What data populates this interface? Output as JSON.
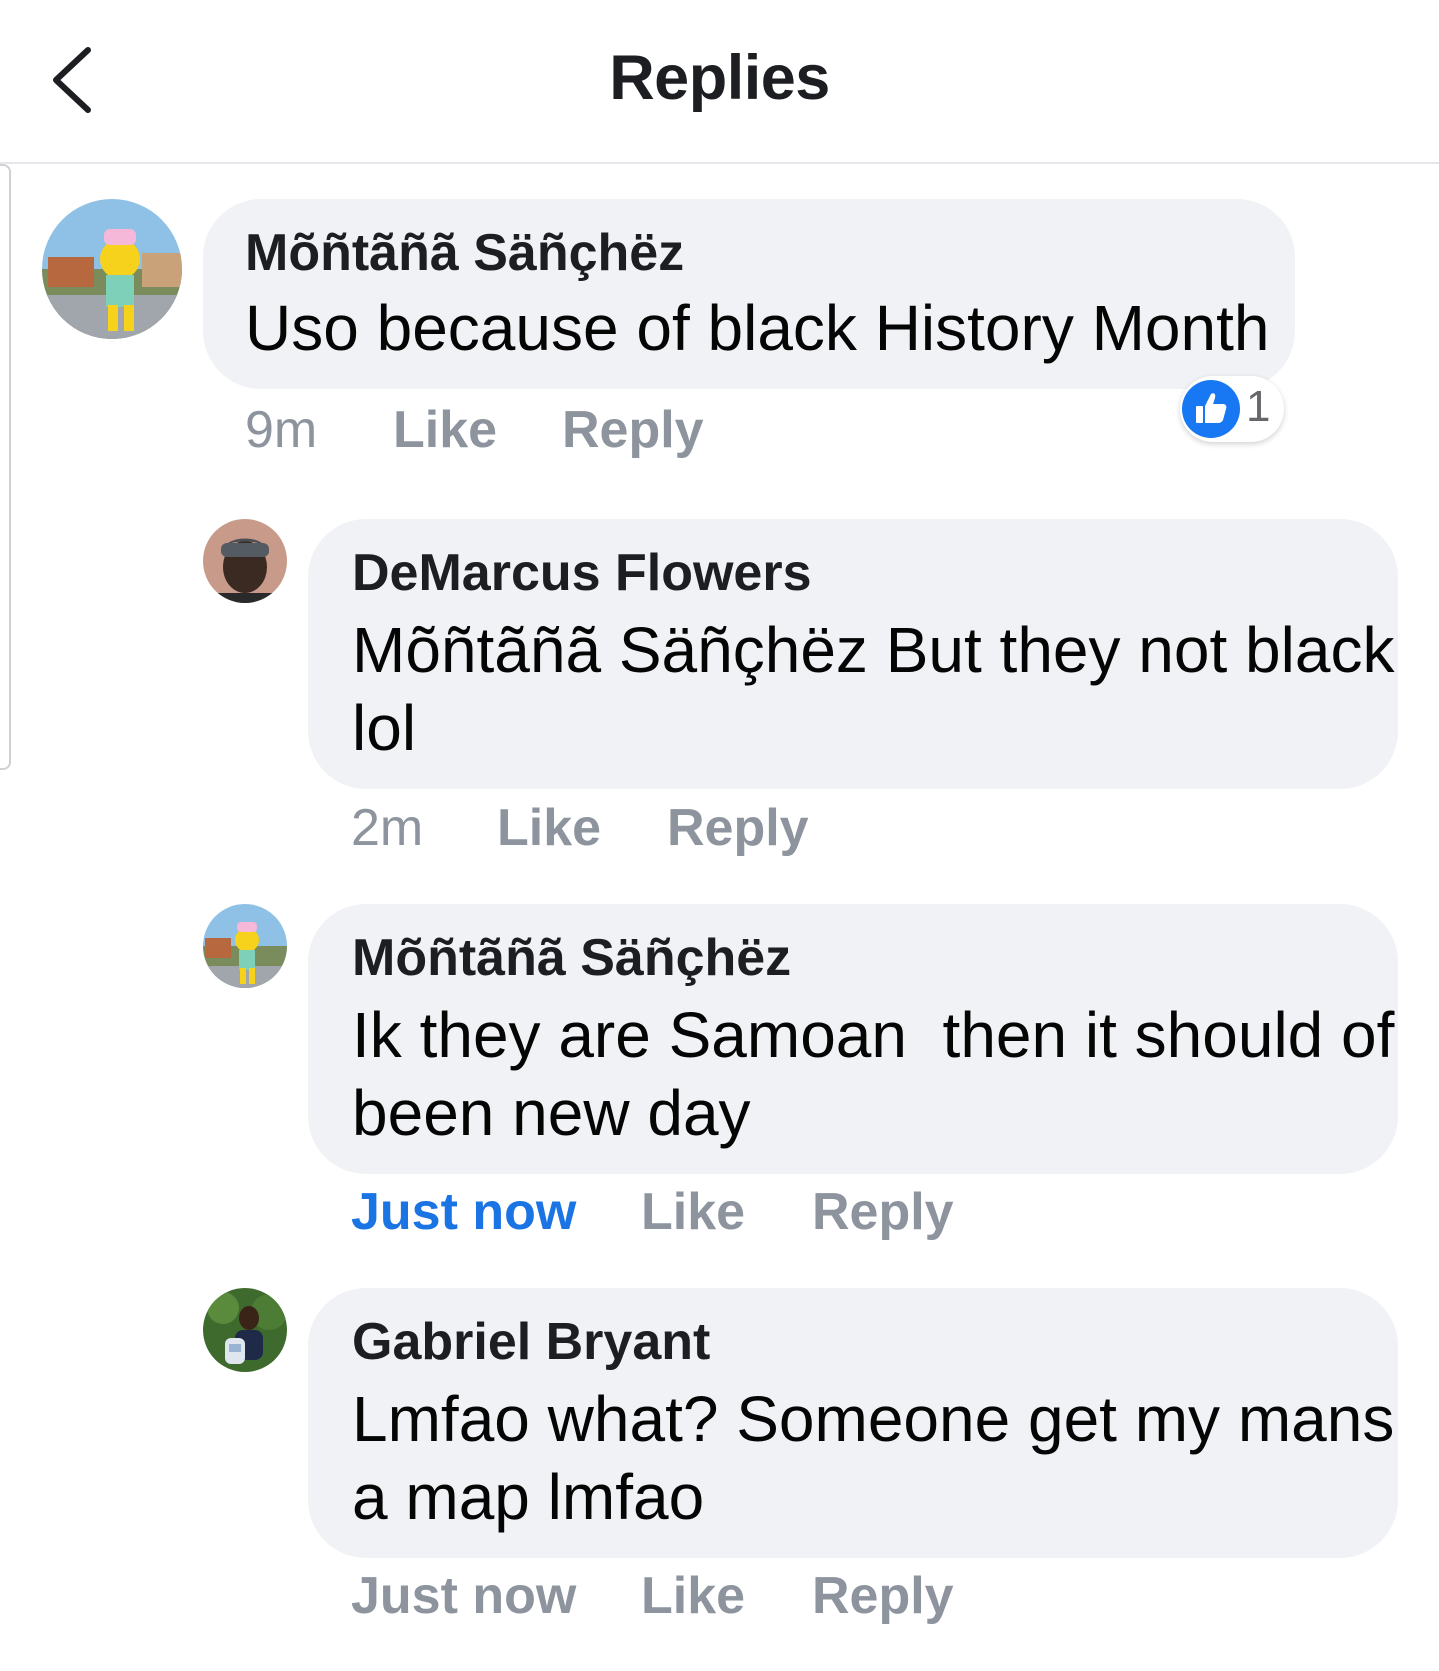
{
  "header": {
    "title": "Replies"
  },
  "comments": [
    {
      "author": "Mõñtãñã Säñçhëz",
      "lines": [
        "Uso because of black History Month"
      ],
      "time": "9m",
      "like_label": "Like",
      "reply_label": "Reply",
      "reactions": {
        "icon": "thumbs-up-icon",
        "count": "1"
      }
    },
    {
      "author": "DeMarcus Flowers",
      "lines": [
        "Mõñtãñã Säñçhëz But they not black",
        "lol"
      ],
      "time": "2m",
      "like_label": "Like",
      "reply_label": "Reply"
    },
    {
      "author": "Mõñtãñã Säñçhëz",
      "lines": [
        "Ik they are Samoan  then it should of",
        "been new day"
      ],
      "time": "Just now",
      "like_label": "Like",
      "reply_label": "Reply"
    },
    {
      "author": "Gabriel Bryant",
      "lines": [
        "Lmfao what? Someone get my mans",
        "a map lmfao"
      ],
      "time": "Just now",
      "like_label": "Like",
      "reply_label": "Reply"
    }
  ],
  "colors": {
    "accent": "#1b74e4",
    "muted": "#8d949e",
    "bubble": "#f0f2f5"
  }
}
